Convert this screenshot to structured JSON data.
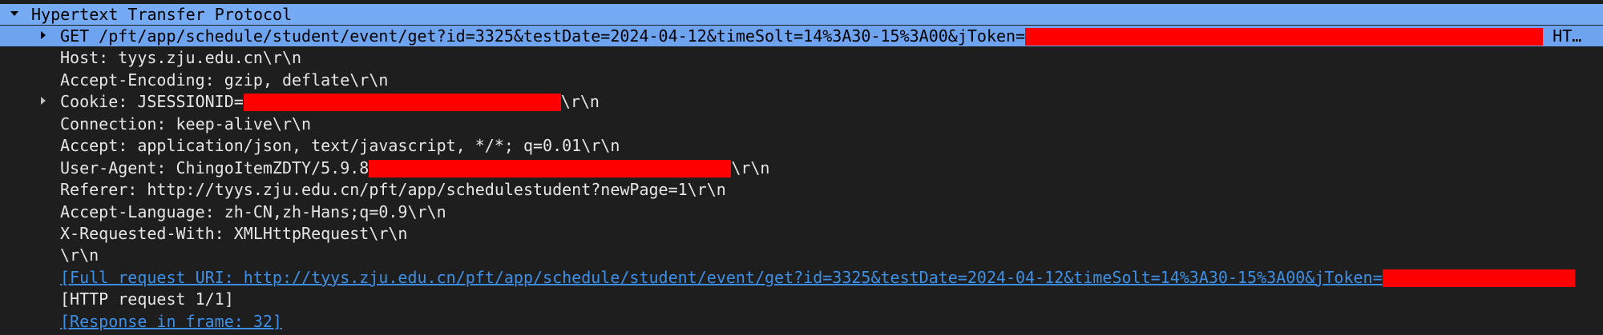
{
  "tree": {
    "root_label": "Hypertext Transfer Protocol",
    "request_line": {
      "prefix": "GET /pft/app/schedule/student/event/get?id=3325&testDate=2024-04-12&timeSolt=14%3A30-15%3A00&jToken=",
      "suffix": " HT…"
    },
    "host": "Host: tyys.zju.edu.cn\\r\\n",
    "accept_encoding": "Accept-Encoding: gzip, deflate\\r\\n",
    "cookie": {
      "prefix": "Cookie: JSESSIONID=",
      "suffix": "\\r\\n"
    },
    "connection": "Connection: keep-alive\\r\\n",
    "accept": "Accept: application/json, text/javascript, */*; q=0.01\\r\\n",
    "user_agent": {
      "prefix": "User-Agent: ChingoItemZDTY/5.9.8",
      "suffix": "\\r\\n"
    },
    "referer": "Referer: http://tyys.zju.edu.cn/pft/app/schedulestudent?newPage=1\\r\\n",
    "accept_language": "Accept-Language: zh-CN,zh-Hans;q=0.9\\r\\n",
    "x_requested_with": "X-Requested-With: XMLHttpRequest\\r\\n",
    "crlf": "\\r\\n",
    "full_request_uri": "[Full request URI: http://tyys.zju.edu.cn/pft/app/schedule/student/event/get?id=3325&testDate=2024-04-12&timeSolt=14%3A30-15%3A00&jToken=",
    "http_request": "[HTTP request 1/1]",
    "response_in_frame": "[Response in frame: 32]"
  },
  "colors": {
    "background": "#1e1e1e",
    "selection": "#75aaf4",
    "link": "#3d8fe6",
    "redaction": "#ff0000"
  },
  "icons": {
    "expanded": "triangle-down-icon",
    "collapsed": "triangle-right-icon"
  }
}
